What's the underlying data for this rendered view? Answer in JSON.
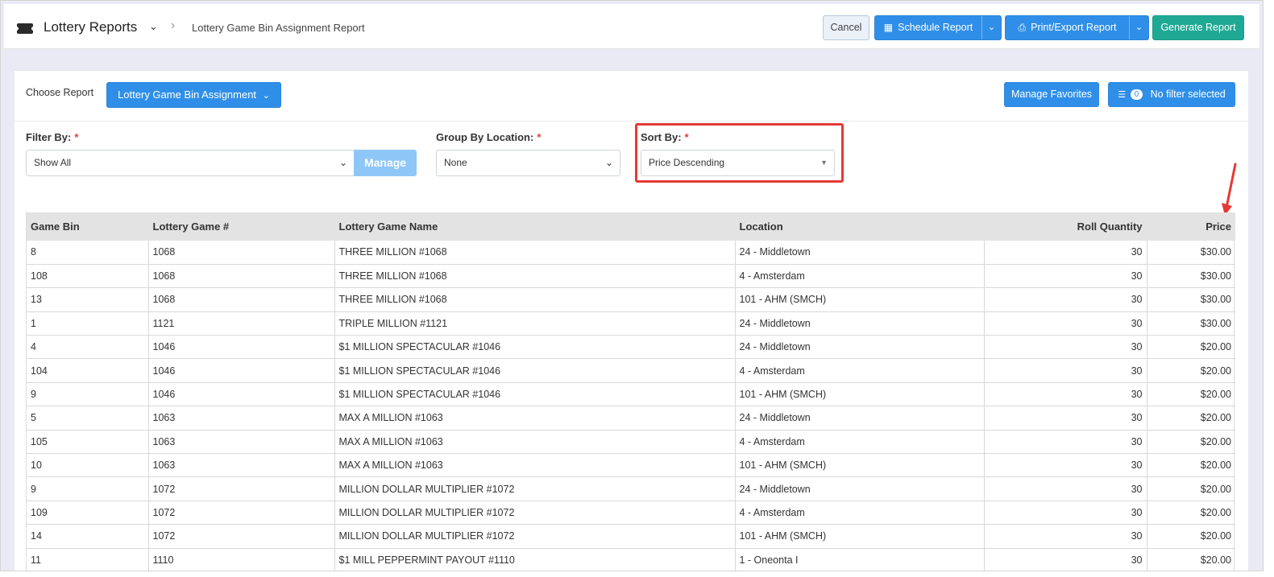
{
  "header": {
    "app_title": "Lottery Reports",
    "breadcrumb": "Lottery Game Bin Assignment Report",
    "cancel_label": "Cancel",
    "schedule_label": "Schedule Report",
    "print_label": "Print/Export Report",
    "generate_label": "Generate Report"
  },
  "toolbar": {
    "choose_label": "Choose Report",
    "report_select": "Lottery Game Bin Assignment",
    "favorites_label": "Manage Favorites",
    "filter_count": "0",
    "filter_status": "No filter selected"
  },
  "filters": {
    "filter_by_label": "Filter By:",
    "filter_by_value": "Show All",
    "manage_label": "Manage",
    "group_label": "Group By Location:",
    "group_value": "None",
    "sort_label": "Sort By:",
    "sort_value": "Price Descending",
    "required_mark": "*"
  },
  "colors": {
    "primary": "#2f8fe8",
    "success": "#1fa994",
    "highlight": "#e53935"
  },
  "icons": [
    "ticket-icon",
    "chevron-down-icon",
    "calendar-icon",
    "printer-icon",
    "list-icon",
    "caret-down-icon"
  ],
  "table": {
    "columns": [
      "Game Bin",
      "Lottery Game #",
      "Lottery Game Name",
      "Location",
      "Roll Quantity",
      "Price"
    ],
    "rows": [
      [
        "8",
        "1068",
        "THREE MILLION #1068",
        "24 - Middletown",
        "30",
        "$30.00"
      ],
      [
        "108",
        "1068",
        "THREE MILLION #1068",
        "4 - Amsterdam",
        "30",
        "$30.00"
      ],
      [
        "13",
        "1068",
        "THREE MILLION #1068",
        "101 - AHM (SMCH)",
        "30",
        "$30.00"
      ],
      [
        "1",
        "1121",
        "TRIPLE MILLION #1121",
        "24 - Middletown",
        "30",
        "$30.00"
      ],
      [
        "4",
        "1046",
        "$1 MILLION SPECTACULAR #1046",
        "24 - Middletown",
        "30",
        "$20.00"
      ],
      [
        "104",
        "1046",
        "$1 MILLION SPECTACULAR #1046",
        "4 - Amsterdam",
        "30",
        "$20.00"
      ],
      [
        "9",
        "1046",
        "$1 MILLION SPECTACULAR #1046",
        "101 - AHM (SMCH)",
        "30",
        "$20.00"
      ],
      [
        "5",
        "1063",
        "MAX A MILLION #1063",
        "24 - Middletown",
        "30",
        "$20.00"
      ],
      [
        "105",
        "1063",
        "MAX A MILLION #1063",
        "4 - Amsterdam",
        "30",
        "$20.00"
      ],
      [
        "10",
        "1063",
        "MAX A MILLION #1063",
        "101 - AHM (SMCH)",
        "30",
        "$20.00"
      ],
      [
        "9",
        "1072",
        "MILLION DOLLAR MULTIPLIER #1072",
        "24 - Middletown",
        "30",
        "$20.00"
      ],
      [
        "109",
        "1072",
        "MILLION DOLLAR MULTIPLIER #1072",
        "4 - Amsterdam",
        "30",
        "$20.00"
      ],
      [
        "14",
        "1072",
        "MILLION DOLLAR MULTIPLIER #1072",
        "101 - AHM (SMCH)",
        "30",
        "$20.00"
      ],
      [
        "11",
        "1110",
        "$1 MILL PEPPERMINT PAYOUT #1110",
        "1 - Oneonta I",
        "30",
        "$20.00"
      ]
    ]
  }
}
